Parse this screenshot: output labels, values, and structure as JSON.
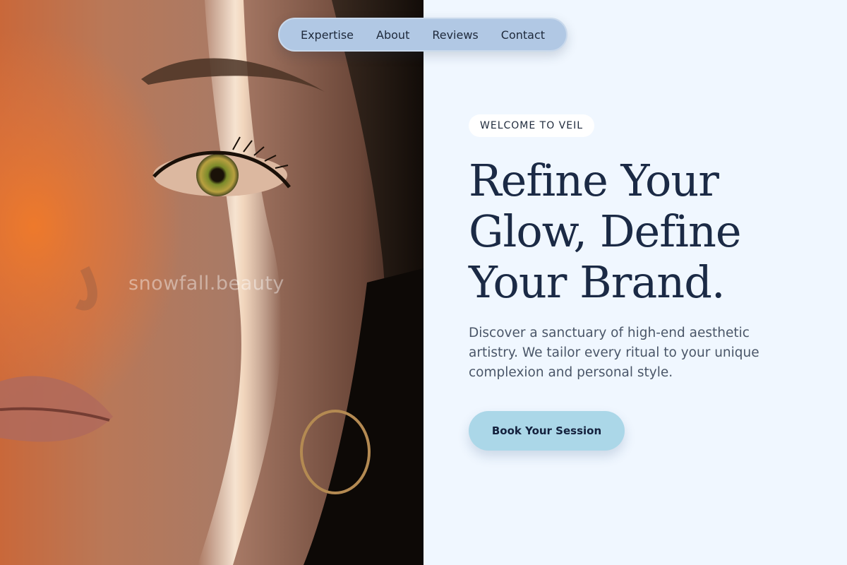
{
  "nav": {
    "items": [
      {
        "label": "Expertise"
      },
      {
        "label": "About"
      },
      {
        "label": "Reviews"
      },
      {
        "label": "Contact"
      }
    ]
  },
  "hero": {
    "image_watermark": "snowfall.beauty",
    "badge": "WELCOME TO VEIL",
    "headline_lines": [
      "Refine Your",
      "Glow, Define",
      "Your Brand."
    ],
    "description": "Discover a sanctuary of high-end aesthetic artistry. We tailor every ritual to your unique complexion and personal style.",
    "cta_label": "Book Your Session"
  },
  "colors": {
    "panel_bg": "#f0f7ff",
    "nav_bg": "#b1c8e4",
    "cta_bg": "#abd7e8",
    "heading": "#1b2a45",
    "body_text": "#4a5668"
  }
}
